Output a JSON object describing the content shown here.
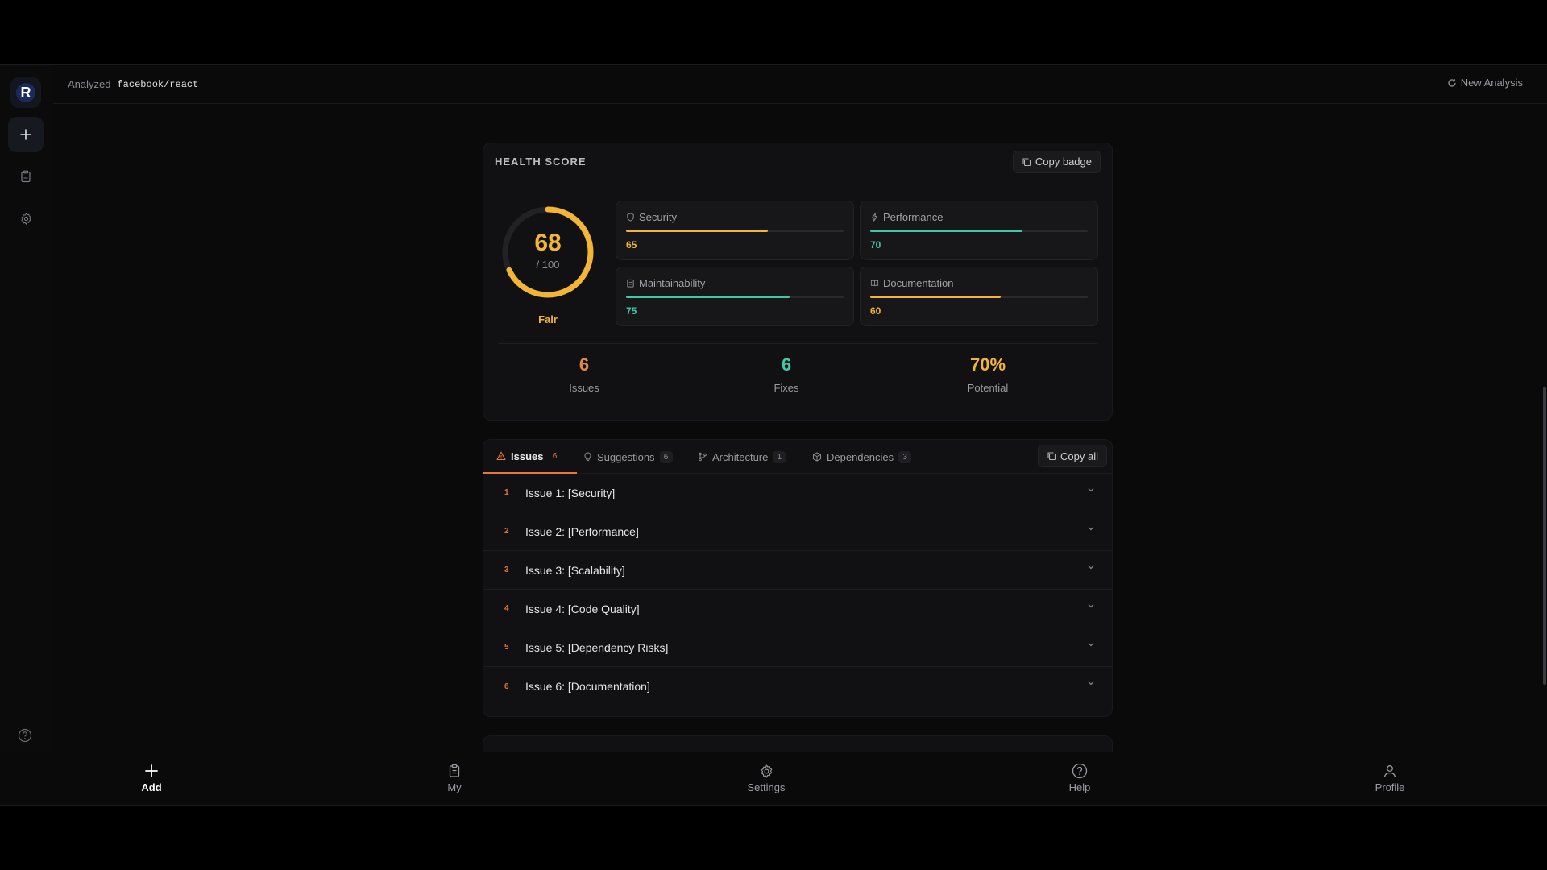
{
  "topbar": {
    "analyzed_label": "Analyzed",
    "repo": "facebook/react",
    "new_analysis": "New Analysis"
  },
  "health": {
    "title": "HEALTH SCORE",
    "copy_badge": "Copy badge",
    "score": "68",
    "score_max": "/ 100",
    "score_fraction": 0.68,
    "grade": "Fair",
    "metrics": [
      {
        "label": "Security",
        "value": "65",
        "fraction": 0.65,
        "color": "#f2b535",
        "icon": "shield-icon"
      },
      {
        "label": "Performance",
        "value": "70",
        "fraction": 0.7,
        "color": "#3ec9a7",
        "icon": "bolt-icon"
      },
      {
        "label": "Maintainability",
        "value": "75",
        "fraction": 0.75,
        "color": "#3ec9a7",
        "icon": "clipboard-icon"
      },
      {
        "label": "Documentation",
        "value": "60",
        "fraction": 0.6,
        "color": "#f2b535",
        "icon": "book-icon"
      }
    ],
    "stats": [
      {
        "value": "6",
        "label": "Issues",
        "color": "#e08a4e"
      },
      {
        "value": "6",
        "label": "Fixes",
        "color": "#3ec9a7"
      },
      {
        "value": "70%",
        "label": "Potential",
        "color": "#f2b535"
      }
    ]
  },
  "tabs": [
    {
      "label": "Issues",
      "count": "6",
      "icon": "warning-icon"
    },
    {
      "label": "Suggestions",
      "count": "6",
      "icon": "lightbulb-icon"
    },
    {
      "label": "Architecture",
      "count": "1",
      "icon": "branch-icon"
    },
    {
      "label": "Dependencies",
      "count": "3",
      "icon": "package-icon"
    }
  ],
  "copy_all": "Copy all",
  "issues": [
    {
      "n": "1",
      "title": "Issue 1: [Security]"
    },
    {
      "n": "2",
      "title": "Issue 2: [Performance]"
    },
    {
      "n": "3",
      "title": "Issue 3: [Scalability]"
    },
    {
      "n": "4",
      "title": "Issue 4: [Code Quality]"
    },
    {
      "n": "5",
      "title": "Issue 5: [Dependency Risks]"
    },
    {
      "n": "6",
      "title": "Issue 6: [Documentation]"
    }
  ],
  "bottomnav": [
    {
      "label": "Add",
      "icon": "plus-icon"
    },
    {
      "label": "My",
      "icon": "clipboard-icon"
    },
    {
      "label": "Settings",
      "icon": "gear-icon"
    },
    {
      "label": "Help",
      "icon": "help-icon"
    },
    {
      "label": "Profile",
      "icon": "user-icon"
    }
  ]
}
